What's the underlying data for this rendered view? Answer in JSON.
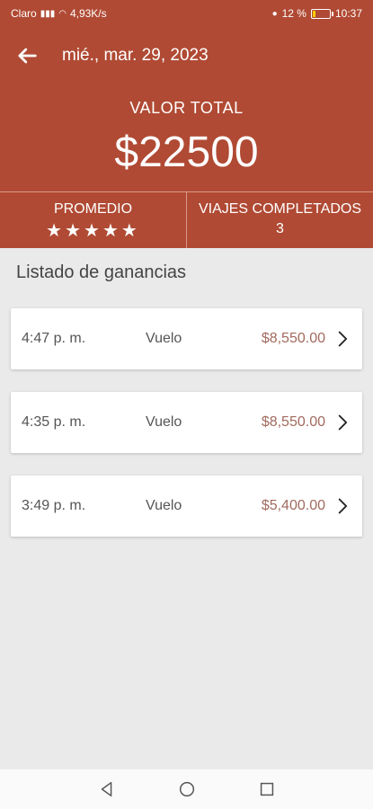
{
  "status_bar": {
    "carrier": "Claro",
    "net_speed": "4,93K/s",
    "battery": "12 %",
    "time": "10:37"
  },
  "header": {
    "date": "mié., mar. 29, 2023",
    "total_label": "VALOR TOTAL",
    "total_value": "$22500",
    "average_label": "PROMEDIO",
    "rating_stars": 5,
    "trips_label": "VIAJES COMPLETADOS",
    "trips_value": "3"
  },
  "list": {
    "title": "Listado de ganancias",
    "items": [
      {
        "time": "4:47 p. m.",
        "type": "Vuelo",
        "amount": "$8,550.00"
      },
      {
        "time": "4:35 p. m.",
        "type": "Vuelo",
        "amount": "$8,550.00"
      },
      {
        "time": "3:49 p. m.",
        "type": "Vuelo",
        "amount": "$5,400.00"
      }
    ]
  },
  "colors": {
    "header_bg": "#b04a34",
    "amount": "#a16a5e",
    "page_bg": "#eaeaea"
  },
  "icons": [
    "back-arrow-icon",
    "star-icon",
    "chevron-right-icon",
    "nav-back-icon",
    "nav-home-icon",
    "nav-recents-icon"
  ]
}
